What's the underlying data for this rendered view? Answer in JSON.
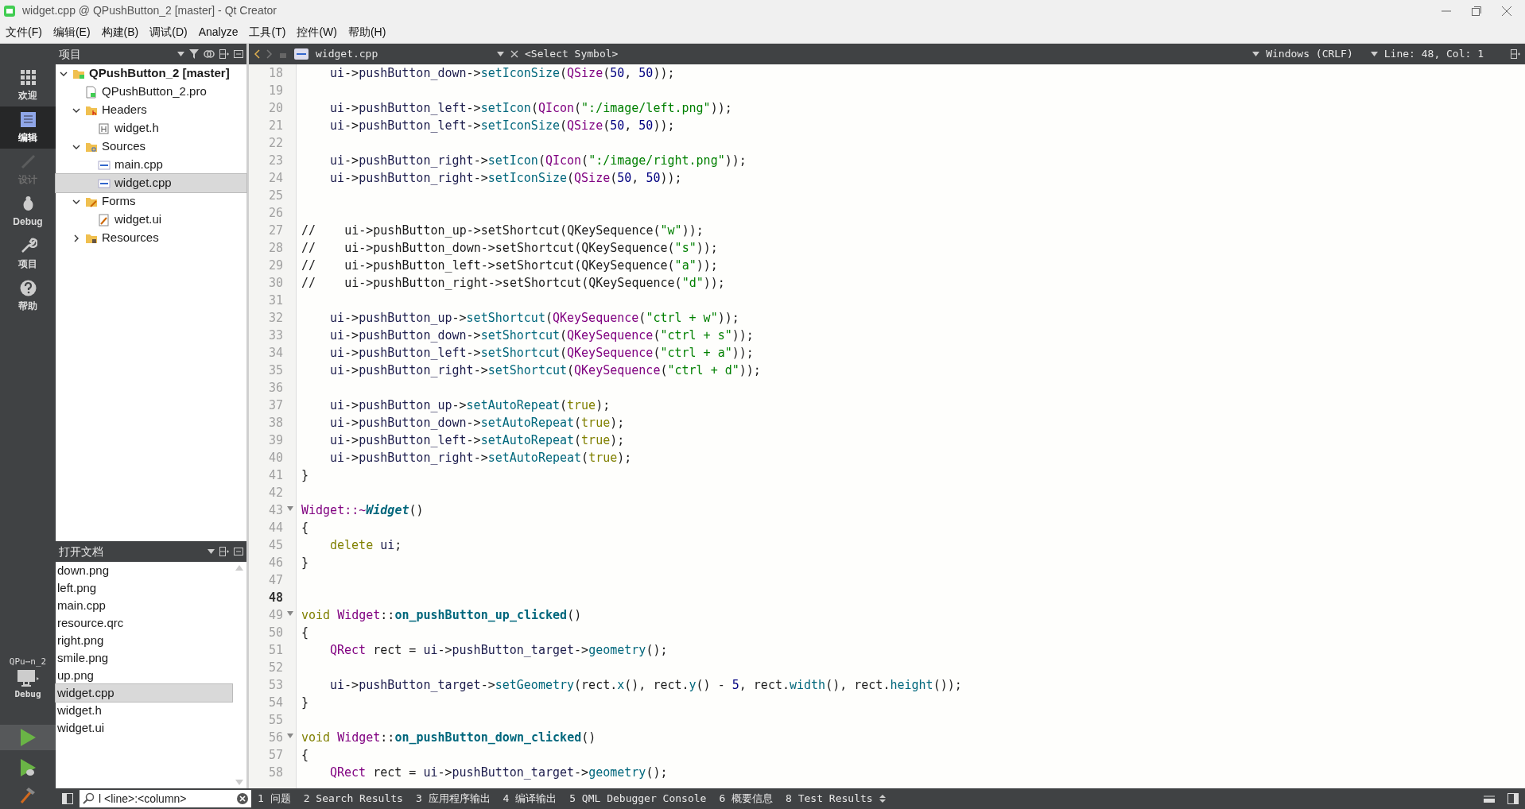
{
  "window": {
    "title": "widget.cpp @ QPushButton_2 [master] - Qt Creator"
  },
  "menu": [
    "文件(F)",
    "编辑(E)",
    "构建(B)",
    "调试(D)",
    "Analyze",
    "工具(T)",
    "控件(W)",
    "帮助(H)"
  ],
  "modes": [
    {
      "kind": "welcome",
      "label": "欢迎",
      "selected": false,
      "disabled": false
    },
    {
      "kind": "edit",
      "label": "编辑",
      "selected": true,
      "disabled": false
    },
    {
      "kind": "design",
      "label": "设计",
      "selected": false,
      "disabled": true
    },
    {
      "kind": "debug",
      "label": "Debug",
      "selected": false,
      "disabled": false
    },
    {
      "kind": "projects",
      "label": "项目",
      "selected": false,
      "disabled": false
    },
    {
      "kind": "help",
      "label": "帮助",
      "selected": false,
      "disabled": false
    }
  ],
  "kit": {
    "project": "QPu⋯n_2",
    "build": "Debug"
  },
  "project_panel": {
    "title": "项目",
    "tree": [
      {
        "kind": "project",
        "label": "QPushButton_2 [master]",
        "expanded": true,
        "selected": false,
        "children": [
          {
            "kind": "pro",
            "label": "QPushButton_2.pro",
            "selected": false
          },
          {
            "kind": "headers",
            "label": "Headers",
            "expanded": true,
            "selected": false,
            "children": [
              {
                "kind": "h",
                "label": "widget.h",
                "selected": false
              }
            ]
          },
          {
            "kind": "sources",
            "label": "Sources",
            "expanded": true,
            "selected": false,
            "children": [
              {
                "kind": "cpp",
                "label": "main.cpp",
                "selected": false
              },
              {
                "kind": "cpp",
                "label": "widget.cpp",
                "selected": true
              }
            ]
          },
          {
            "kind": "forms",
            "label": "Forms",
            "expanded": true,
            "selected": false,
            "children": [
              {
                "kind": "ui",
                "label": "widget.ui",
                "selected": false
              }
            ]
          },
          {
            "kind": "resources",
            "label": "Resources",
            "expanded": false,
            "selected": false
          }
        ]
      }
    ]
  },
  "open_documents": {
    "title": "打开文档",
    "items": [
      {
        "label": "down.png",
        "selected": false
      },
      {
        "label": "left.png",
        "selected": false
      },
      {
        "label": "main.cpp",
        "selected": false
      },
      {
        "label": "resource.qrc",
        "selected": false
      },
      {
        "label": "right.png",
        "selected": false
      },
      {
        "label": "smile.png",
        "selected": false
      },
      {
        "label": "up.png",
        "selected": false
      },
      {
        "label": "widget.cpp",
        "selected": true
      },
      {
        "label": "widget.h",
        "selected": false
      },
      {
        "label": "widget.ui",
        "selected": false
      }
    ]
  },
  "editor": {
    "file": "widget.cpp",
    "symbol": "<Select Symbol>",
    "encoding": "Windows (CRLF)",
    "position": "Line: 48, Col: 1",
    "lines": [
      {
        "number": "18",
        "current": false,
        "indented": true,
        "tokens": [
          {
            "text": "ui",
            "kind": "field"
          },
          {
            "text": "->",
            "kind": "plain"
          },
          {
            "text": "pushButton_down",
            "kind": "field"
          },
          {
            "text": "->",
            "kind": "plain"
          },
          {
            "text": "setIconSize",
            "kind": "method"
          },
          {
            "text": "(",
            "kind": "plain"
          },
          {
            "text": "QSize",
            "kind": "type"
          },
          {
            "text": "(",
            "kind": "plain"
          },
          {
            "text": "50",
            "kind": "number"
          },
          {
            "text": ", ",
            "kind": "plain"
          },
          {
            "text": "50",
            "kind": "number"
          },
          {
            "text": "));",
            "kind": "plain"
          }
        ]
      },
      {
        "number": "19",
        "current": false
      },
      {
        "number": "20",
        "current": false,
        "indented": true,
        "tokens": [
          {
            "text": "ui",
            "kind": "field"
          },
          {
            "text": "->",
            "kind": "plain"
          },
          {
            "text": "pushButton_left",
            "kind": "field"
          },
          {
            "text": "->",
            "kind": "plain"
          },
          {
            "text": "setIcon",
            "kind": "method"
          },
          {
            "text": "(",
            "kind": "plain"
          },
          {
            "text": "QIcon",
            "kind": "type"
          },
          {
            "text": "(",
            "kind": "plain"
          },
          {
            "text": "\":/image/left.png\"",
            "kind": "string"
          },
          {
            "text": "));",
            "kind": "plain"
          }
        ]
      },
      {
        "number": "21",
        "current": false,
        "indented": true,
        "tokens": [
          {
            "text": "ui",
            "kind": "field"
          },
          {
            "text": "->",
            "kind": "plain"
          },
          {
            "text": "pushButton_left",
            "kind": "field"
          },
          {
            "text": "->",
            "kind": "plain"
          },
          {
            "text": "setIconSize",
            "kind": "method"
          },
          {
            "text": "(",
            "kind": "plain"
          },
          {
            "text": "QSize",
            "kind": "type"
          },
          {
            "text": "(",
            "kind": "plain"
          },
          {
            "text": "50",
            "kind": "number"
          },
          {
            "text": ", ",
            "kind": "plain"
          },
          {
            "text": "50",
            "kind": "number"
          },
          {
            "text": "));",
            "kind": "plain"
          }
        ]
      },
      {
        "number": "22",
        "current": false
      },
      {
        "number": "23",
        "current": false,
        "indented": true,
        "tokens": [
          {
            "text": "ui",
            "kind": "field"
          },
          {
            "text": "->",
            "kind": "plain"
          },
          {
            "text": "pushButton_right",
            "kind": "field"
          },
          {
            "text": "->",
            "kind": "plain"
          },
          {
            "text": "setIcon",
            "kind": "method"
          },
          {
            "text": "(",
            "kind": "plain"
          },
          {
            "text": "QIcon",
            "kind": "type"
          },
          {
            "text": "(",
            "kind": "plain"
          },
          {
            "text": "\":/image/right.png\"",
            "kind": "string"
          },
          {
            "text": "));",
            "kind": "plain"
          }
        ]
      },
      {
        "number": "24",
        "current": false,
        "indented": true,
        "tokens": [
          {
            "text": "ui",
            "kind": "field"
          },
          {
            "text": "->",
            "kind": "plain"
          },
          {
            "text": "pushButton_right",
            "kind": "field"
          },
          {
            "text": "->",
            "kind": "plain"
          },
          {
            "text": "setIconSize",
            "kind": "method"
          },
          {
            "text": "(",
            "kind": "plain"
          },
          {
            "text": "QSize",
            "kind": "type"
          },
          {
            "text": "(",
            "kind": "plain"
          },
          {
            "text": "50",
            "kind": "number"
          },
          {
            "text": ", ",
            "kind": "plain"
          },
          {
            "text": "50",
            "kind": "number"
          },
          {
            "text": "));",
            "kind": "plain"
          }
        ]
      },
      {
        "number": "25",
        "current": false
      },
      {
        "number": "26",
        "current": false
      },
      {
        "number": "27",
        "current": false,
        "tokens": [
          {
            "text": "//    ui->pushButton_up->setShortcut(QKeySequence(",
            "kind": "plain"
          },
          {
            "text": "\"w\"",
            "kind": "string"
          },
          {
            "text": "));",
            "kind": "plain"
          }
        ]
      },
      {
        "number": "28",
        "current": false,
        "tokens": [
          {
            "text": "//    ui->pushButton_down->setShortcut(QKeySequence(",
            "kind": "plain"
          },
          {
            "text": "\"s\"",
            "kind": "string"
          },
          {
            "text": "));",
            "kind": "plain"
          }
        ]
      },
      {
        "number": "29",
        "current": false,
        "tokens": [
          {
            "text": "//    ui->pushButton_left->setShortcut(QKeySequence(",
            "kind": "plain"
          },
          {
            "text": "\"a\"",
            "kind": "string"
          },
          {
            "text": "));",
            "kind": "plain"
          }
        ]
      },
      {
        "number": "30",
        "current": false,
        "tokens": [
          {
            "text": "//    ui->pushButton_right->setShortcut(QKeySequence(",
            "kind": "plain"
          },
          {
            "text": "\"d\"",
            "kind": "string"
          },
          {
            "text": "));",
            "kind": "plain"
          }
        ]
      },
      {
        "number": "31",
        "current": false
      },
      {
        "number": "32",
        "current": false,
        "indented": true,
        "tokens": [
          {
            "text": "ui",
            "kind": "field"
          },
          {
            "text": "->",
            "kind": "plain"
          },
          {
            "text": "pushButton_up",
            "kind": "field"
          },
          {
            "text": "->",
            "kind": "plain"
          },
          {
            "text": "setShortcut",
            "kind": "method"
          },
          {
            "text": "(",
            "kind": "plain"
          },
          {
            "text": "QKeySequence",
            "kind": "type"
          },
          {
            "text": "(",
            "kind": "plain"
          },
          {
            "text": "\"ctrl + w\"",
            "kind": "string"
          },
          {
            "text": "));",
            "kind": "plain"
          }
        ]
      },
      {
        "number": "33",
        "current": false,
        "indented": true,
        "tokens": [
          {
            "text": "ui",
            "kind": "field"
          },
          {
            "text": "->",
            "kind": "plain"
          },
          {
            "text": "pushButton_down",
            "kind": "field"
          },
          {
            "text": "->",
            "kind": "plain"
          },
          {
            "text": "setShortcut",
            "kind": "method"
          },
          {
            "text": "(",
            "kind": "plain"
          },
          {
            "text": "QKeySequence",
            "kind": "type"
          },
          {
            "text": "(",
            "kind": "plain"
          },
          {
            "text": "\"ctrl + s\"",
            "kind": "string"
          },
          {
            "text": "));",
            "kind": "plain"
          }
        ]
      },
      {
        "number": "34",
        "current": false,
        "indented": true,
        "tokens": [
          {
            "text": "ui",
            "kind": "field"
          },
          {
            "text": "->",
            "kind": "plain"
          },
          {
            "text": "pushButton_left",
            "kind": "field"
          },
          {
            "text": "->",
            "kind": "plain"
          },
          {
            "text": "setShortcut",
            "kind": "method"
          },
          {
            "text": "(",
            "kind": "plain"
          },
          {
            "text": "QKeySequence",
            "kind": "type"
          },
          {
            "text": "(",
            "kind": "plain"
          },
          {
            "text": "\"ctrl + a\"",
            "kind": "string"
          },
          {
            "text": "));",
            "kind": "plain"
          }
        ]
      },
      {
        "number": "35",
        "current": false,
        "indented": true,
        "tokens": [
          {
            "text": "ui",
            "kind": "field"
          },
          {
            "text": "->",
            "kind": "plain"
          },
          {
            "text": "pushButton_right",
            "kind": "field"
          },
          {
            "text": "->",
            "kind": "plain"
          },
          {
            "text": "setShortcut",
            "kind": "method"
          },
          {
            "text": "(",
            "kind": "plain"
          },
          {
            "text": "QKeySequence",
            "kind": "type"
          },
          {
            "text": "(",
            "kind": "plain"
          },
          {
            "text": "\"ctrl + d\"",
            "kind": "string"
          },
          {
            "text": "));",
            "kind": "plain"
          }
        ]
      },
      {
        "number": "36",
        "current": false
      },
      {
        "number": "37",
        "current": false,
        "indented": true,
        "tokens": [
          {
            "text": "ui",
            "kind": "field"
          },
          {
            "text": "->",
            "kind": "plain"
          },
          {
            "text": "pushButton_up",
            "kind": "field"
          },
          {
            "text": "->",
            "kind": "plain"
          },
          {
            "text": "setAutoRepeat",
            "kind": "method"
          },
          {
            "text": "(",
            "kind": "plain"
          },
          {
            "text": "true",
            "kind": "keyword"
          },
          {
            "text": ");",
            "kind": "plain"
          }
        ]
      },
      {
        "number": "38",
        "current": false,
        "indented": true,
        "tokens": [
          {
            "text": "ui",
            "kind": "field"
          },
          {
            "text": "->",
            "kind": "plain"
          },
          {
            "text": "pushButton_down",
            "kind": "field"
          },
          {
            "text": "->",
            "kind": "plain"
          },
          {
            "text": "setAutoRepeat",
            "kind": "method"
          },
          {
            "text": "(",
            "kind": "plain"
          },
          {
            "text": "true",
            "kind": "keyword"
          },
          {
            "text": ");",
            "kind": "plain"
          }
        ]
      },
      {
        "number": "39",
        "current": false,
        "indented": true,
        "tokens": [
          {
            "text": "ui",
            "kind": "field"
          },
          {
            "text": "->",
            "kind": "plain"
          },
          {
            "text": "pushButton_left",
            "kind": "field"
          },
          {
            "text": "->",
            "kind": "plain"
          },
          {
            "text": "setAutoRepeat",
            "kind": "method"
          },
          {
            "text": "(",
            "kind": "plain"
          },
          {
            "text": "true",
            "kind": "keyword"
          },
          {
            "text": ");",
            "kind": "plain"
          }
        ]
      },
      {
        "number": "40",
        "current": false,
        "indented": true,
        "tokens": [
          {
            "text": "ui",
            "kind": "field"
          },
          {
            "text": "->",
            "kind": "plain"
          },
          {
            "text": "pushButton_right",
            "kind": "field"
          },
          {
            "text": "->",
            "kind": "plain"
          },
          {
            "text": "setAutoRepeat",
            "kind": "method"
          },
          {
            "text": "(",
            "kind": "plain"
          },
          {
            "text": "true",
            "kind": "keyword"
          },
          {
            "text": ");",
            "kind": "plain"
          }
        ]
      },
      {
        "number": "41",
        "current": false,
        "tokens": [
          {
            "text": "}",
            "kind": "plain"
          }
        ]
      },
      {
        "number": "42",
        "current": false
      },
      {
        "number": "43",
        "current": false,
        "foldable": true,
        "tokens": [
          {
            "text": "Widget::~",
            "kind": "type"
          },
          {
            "text": "Widget",
            "kind": "declaration"
          },
          {
            "text": "()",
            "kind": "plain"
          }
        ]
      },
      {
        "number": "44",
        "current": false,
        "tokens": [
          {
            "text": "{",
            "kind": "plain"
          }
        ]
      },
      {
        "number": "45",
        "current": false,
        "indented": true,
        "tokens": [
          {
            "text": "delete ",
            "kind": "keyword"
          },
          {
            "text": "ui",
            "kind": "field"
          },
          {
            "text": ";",
            "kind": "plain"
          }
        ]
      },
      {
        "number": "46",
        "current": false,
        "tokens": [
          {
            "text": "}",
            "kind": "plain"
          }
        ]
      },
      {
        "number": "47",
        "current": false
      },
      {
        "number": "48",
        "current": true
      },
      {
        "number": "49",
        "current": false,
        "foldable": true,
        "tokens": [
          {
            "text": "void ",
            "kind": "keyword"
          },
          {
            "text": "Widget",
            "kind": "type"
          },
          {
            "text": "::",
            "kind": "plain"
          },
          {
            "text": "on_pushButton_up_clicked",
            "kind": "definition"
          },
          {
            "text": "()",
            "kind": "plain"
          }
        ]
      },
      {
        "number": "50",
        "current": false,
        "tokens": [
          {
            "text": "{",
            "kind": "plain"
          }
        ]
      },
      {
        "number": "51",
        "current": false,
        "indented": true,
        "tokens": [
          {
            "text": "QRect",
            "kind": "type"
          },
          {
            "text": " rect = ",
            "kind": "plain"
          },
          {
            "text": "ui",
            "kind": "field"
          },
          {
            "text": "->",
            "kind": "plain"
          },
          {
            "text": "pushButton_target",
            "kind": "field"
          },
          {
            "text": "->",
            "kind": "plain"
          },
          {
            "text": "geometry",
            "kind": "method"
          },
          {
            "text": "();",
            "kind": "plain"
          }
        ]
      },
      {
        "number": "52",
        "current": false
      },
      {
        "number": "53",
        "current": false,
        "indented": true,
        "tokens": [
          {
            "text": "ui",
            "kind": "field"
          },
          {
            "text": "->",
            "kind": "plain"
          },
          {
            "text": "pushButton_target",
            "kind": "field"
          },
          {
            "text": "->",
            "kind": "plain"
          },
          {
            "text": "setGeometry",
            "kind": "method"
          },
          {
            "text": "(rect.",
            "kind": "plain"
          },
          {
            "text": "x",
            "kind": "method"
          },
          {
            "text": "(), rect.",
            "kind": "plain"
          },
          {
            "text": "y",
            "kind": "method"
          },
          {
            "text": "() - ",
            "kind": "plain"
          },
          {
            "text": "5",
            "kind": "number"
          },
          {
            "text": ", rect.",
            "kind": "plain"
          },
          {
            "text": "width",
            "kind": "method"
          },
          {
            "text": "(), rect.",
            "kind": "plain"
          },
          {
            "text": "height",
            "kind": "method"
          },
          {
            "text": "());",
            "kind": "plain"
          }
        ]
      },
      {
        "number": "54",
        "current": false,
        "tokens": [
          {
            "text": "}",
            "kind": "plain"
          }
        ]
      },
      {
        "number": "55",
        "current": false
      },
      {
        "number": "56",
        "current": false,
        "foldable": true,
        "tokens": [
          {
            "text": "void ",
            "kind": "keyword"
          },
          {
            "text": "Widget",
            "kind": "type"
          },
          {
            "text": "::",
            "kind": "plain"
          },
          {
            "text": "on_pushButton_down_clicked",
            "kind": "definition"
          },
          {
            "text": "()",
            "kind": "plain"
          }
        ]
      },
      {
        "number": "57",
        "current": false,
        "tokens": [
          {
            "text": "{",
            "kind": "plain"
          }
        ]
      },
      {
        "number": "58",
        "current": false,
        "indented": true,
        "tokens": [
          {
            "text": "QRect",
            "kind": "type"
          },
          {
            "text": " rect = ",
            "kind": "plain"
          },
          {
            "text": "ui",
            "kind": "field"
          },
          {
            "text": "->",
            "kind": "plain"
          },
          {
            "text": "pushButton_target",
            "kind": "field"
          },
          {
            "text": "->",
            "kind": "plain"
          },
          {
            "text": "geometry",
            "kind": "method"
          },
          {
            "text": "();",
            "kind": "plain"
          }
        ]
      }
    ]
  },
  "status_bar": {
    "locator": {
      "placeholder": "l <line>:<column>"
    },
    "panes": [
      "1 问题",
      "2 Search Results",
      "3 应用程序输出",
      "4 编译输出",
      "5 QML Debugger Console",
      "6 概要信息",
      "8 Test Results"
    ]
  }
}
